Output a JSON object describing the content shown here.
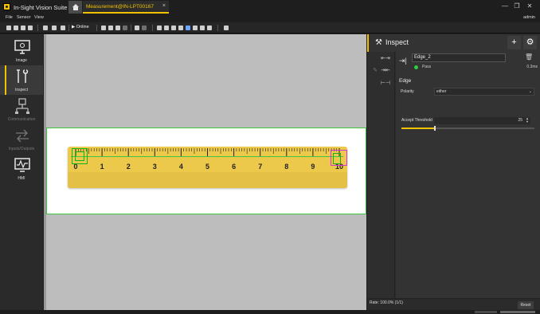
{
  "app": {
    "title": "In-Sight Vision Suite",
    "document_tab": "Measurement@IN-LPT00167",
    "close_glyph": "×",
    "window_buttons": [
      "—",
      "❐",
      "✕"
    ]
  },
  "menu": {
    "items": [
      "File",
      "Sensor",
      "View"
    ],
    "user": "admin"
  },
  "toolbar": {
    "online_label": "Online"
  },
  "nav": {
    "items": [
      {
        "label": "Image",
        "icon": "monitor-icon",
        "state": "normal"
      },
      {
        "label": "Inspect",
        "icon": "tools-icon",
        "state": "active"
      },
      {
        "label": "Communication",
        "icon": "network-icon",
        "state": "disabled"
      },
      {
        "label": "Inputs/Outputs",
        "icon": "io-icon",
        "state": "disabled"
      },
      {
        "label": "HMI",
        "icon": "hmi-icon",
        "state": "normal"
      }
    ]
  },
  "ruler": {
    "numbers": [
      "0",
      "1",
      "2",
      "3",
      "4",
      "5",
      "6",
      "7",
      "8",
      "9",
      "10"
    ]
  },
  "inspect": {
    "title": "Inspect",
    "add_glyph": "+",
    "settings_glyph": "⚙",
    "tool_name": "Edge_2",
    "status": "Pass",
    "exec_time": "0.3ms",
    "section": "Edge",
    "polarity_label": "Polarity",
    "polarity_value": "either",
    "threshold_label": "Accept Threshold",
    "threshold_value": "25",
    "threshold_fraction": 0.25,
    "rate": "Rate: 100.0% (1/1)",
    "reset_label": "Reset"
  },
  "colors": {
    "accent": "#f2c200",
    "pass": "#2ecc40",
    "roi": "#3ec43e",
    "edge_marker": "#d03ad0",
    "ruler": "#ecc94a"
  }
}
